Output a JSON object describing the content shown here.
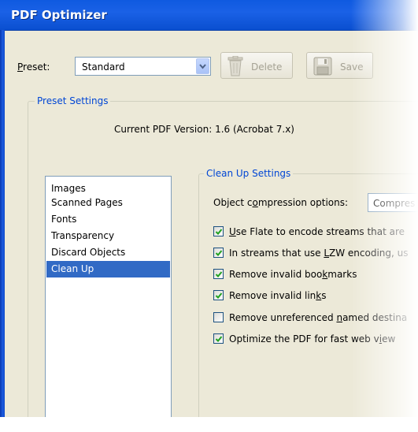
{
  "window": {
    "title": "PDF Optimizer"
  },
  "preset": {
    "label_mnemonic": "P",
    "label_rest": "reset:",
    "selected": "Standard",
    "delete_label": "Delete",
    "save_label": "Save"
  },
  "preset_settings": {
    "title": "Preset Settings",
    "current_version": "Current PDF Version: 1.6 (Acrobat 7.x)"
  },
  "sidebar": {
    "items": [
      {
        "label": "Images",
        "selected": false
      },
      {
        "label": "Scanned Pages",
        "selected": false
      },
      {
        "label": "Fonts",
        "selected": false
      },
      {
        "label": "Transparency",
        "selected": false
      },
      {
        "label": "Discard Objects",
        "selected": false
      },
      {
        "label": "Clean Up",
        "selected": true
      }
    ]
  },
  "cleanup": {
    "title": "Clean Up Settings",
    "compression_label_pre": "Object c",
    "compression_label_mnemonic": "o",
    "compression_label_post": "mpression options:",
    "compression_value": "Compres",
    "options": [
      {
        "pre": "",
        "mn": "U",
        "post": "se Flate to encode streams that are",
        "checked": true
      },
      {
        "pre": "In streams that use ",
        "mn": "L",
        "post": "ZW encoding, us",
        "checked": true
      },
      {
        "pre": "Remove invalid boo",
        "mn": "k",
        "post": "marks",
        "checked": true
      },
      {
        "pre": "Remove invalid lin",
        "mn": "k",
        "post": "s",
        "checked": true
      },
      {
        "pre": "Remove unreferenced ",
        "mn": "n",
        "post": "amed destina",
        "checked": false
      },
      {
        "pre": "Optimize the PDF for fast web v",
        "mn": "i",
        "post": "ew",
        "checked": true
      }
    ]
  },
  "colors": {
    "titlebar": "#0f5ae0",
    "group_title": "#0046d5",
    "selection": "#316ac5",
    "checkmark": "#21a121",
    "dialog_bg": "#ece9d8"
  }
}
